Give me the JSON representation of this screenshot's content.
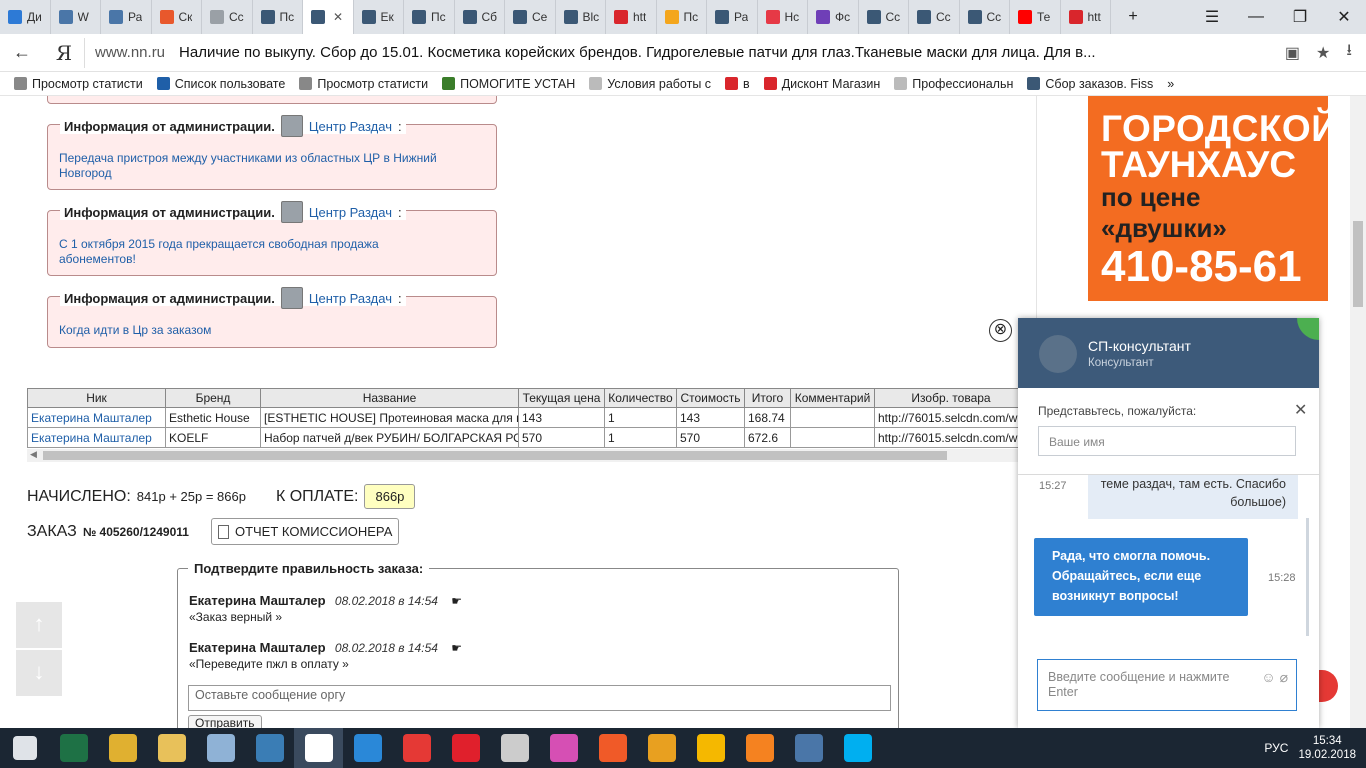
{
  "tabs": [
    {
      "label": "Ди",
      "color": "#2d7ad6"
    },
    {
      "label": "W",
      "color": "#4a76a8"
    },
    {
      "label": "Ра",
      "color": "#4a76a8"
    },
    {
      "label": "Ск",
      "color": "#e8582c"
    },
    {
      "label": "Сс",
      "color": "#9aa0a6"
    },
    {
      "label": "Пс",
      "color": "#3b5875"
    },
    {
      "label": "",
      "color": "#3b5875",
      "active": true
    },
    {
      "label": "Ек",
      "color": "#3b5875"
    },
    {
      "label": "Пс",
      "color": "#3b5875"
    },
    {
      "label": "Сб",
      "color": "#3b5875"
    },
    {
      "label": "Се",
      "color": "#3b5875"
    },
    {
      "label": "Blc",
      "color": "#3b5875"
    },
    {
      "label": "htt",
      "color": "#d9262c"
    },
    {
      "label": "Пс",
      "color": "#f4a61c"
    },
    {
      "label": "Ра",
      "color": "#3b5875"
    },
    {
      "label": "Нс",
      "color": "#e63946"
    },
    {
      "label": "Фс",
      "color": "#6f3fb7"
    },
    {
      "label": "Сс",
      "color": "#3b5875"
    },
    {
      "label": "Сс",
      "color": "#3b5875"
    },
    {
      "label": "Сс",
      "color": "#3b5875"
    },
    {
      "label": "Те",
      "color": "#ff0000"
    },
    {
      "label": "htt",
      "color": "#d9262c"
    }
  ],
  "window": {
    "new_tab": "+",
    "menu": "☰",
    "minimize": "—",
    "maximize": "❐",
    "close": "✕"
  },
  "address": {
    "back": "←",
    "yandex": "Я",
    "domain": "www.nn.ru",
    "title": "Наличие по выкупу. Сбор до 15.01. Косметика корейских брендов. Гидрогелевые патчи для глаз.Тканевые маски для лица. Для в...",
    "download": "⭳",
    "star": "★",
    "lock": "▣"
  },
  "bookmarks": [
    {
      "label": "Просмотр статисти",
      "color": "#888"
    },
    {
      "label": "Список пользовате",
      "color": "#1f5fa8"
    },
    {
      "label": "Просмотр статисти",
      "color": "#888"
    },
    {
      "label": "ПОМОГИТЕ УСТАН",
      "color": "#3a7d2a"
    },
    {
      "label": "Условия работы с",
      "color": "#bbb"
    },
    {
      "label": "в",
      "color": "#d9262c"
    },
    {
      "label": "Дисконт Магазин",
      "color": "#d9262c"
    },
    {
      "label": "Профессиональн",
      "color": "#bbb"
    },
    {
      "label": "Сбор заказов. Fiss",
      "color": "#3b5875"
    }
  ],
  "bookmarks_more": "»",
  "admin": {
    "heading": "Информация от администрации.",
    "who": "Центр Раздач",
    "colon": ":",
    "items": [
      {
        "text": "Передача пристроя между участниками из областных ЦР в Нижний Новгород"
      },
      {
        "text": "С 1 октября 2015 года прекращается свободная продажа абонементов!"
      },
      {
        "text": "Когда идти в Цр за заказом"
      }
    ]
  },
  "close_symbol": "⊗",
  "table": {
    "headers": [
      "Ник",
      "Бренд",
      "Название",
      "Текущая цена",
      "Количество",
      "Стоимость",
      "Итого",
      "Комментарий",
      "Изобр. товара"
    ],
    "rows": [
      [
        "Екатерина Машталер",
        "Esthetic House",
        "[ESTHETIC HOUSE] Протеиновая маска для волос",
        "143",
        "1",
        "143",
        "168.74",
        "",
        "http://76015.selcdn.com/w"
      ],
      [
        "Екатерина Машталер",
        "KOELF",
        "Набор патчей д/век РУБИН/ БОЛГАРСКАЯ РОЗА",
        "570",
        "1",
        "570",
        "672.6",
        "",
        "http://76015.selcdn.com/w"
      ]
    ]
  },
  "summary": {
    "charged_label": "НАЧИСЛЕНО:",
    "charged_value": "841р + 25р = 866р",
    "to_pay_label": "К ОПЛАТЕ:",
    "to_pay_value": "866р",
    "order_label": "ЗАКАЗ",
    "order_number": "№ 405260/1249011",
    "report_button": "ОТЧЕТ КОМИССИОНЕРА"
  },
  "confirm": {
    "legend": "Подтвердите правильность заказа:",
    "messages": [
      {
        "author": "Екатерина Машталер",
        "date": "08.02.2018 в 14:54",
        "text": "«Заказ верный »"
      },
      {
        "author": "Екатерина Машталер",
        "date": "08.02.2018 в 14:54",
        "text": "«Переведите пжл в оплату »"
      }
    ],
    "hand": "☛",
    "placeholder": "Оставьте сообщение оргу",
    "send": "Отправить"
  },
  "scroll_buttons": {
    "up": "↑",
    "down": "↓"
  },
  "ad": {
    "line1": "ГОРОДСКОЙ",
    "line2": "ТАУНХАУС",
    "line3": "по цене «двушки»",
    "phone": "410-85-61",
    "bg_color": "#f36c21"
  },
  "chat": {
    "name": "СП-консультант",
    "role": "Консультант",
    "prompt": "Представьтесь, пожалуйста:",
    "close": "✕",
    "name_placeholder": "Ваше имя",
    "msg1_text": "теме раздач, там есть. Спасибо большое)",
    "msg1_time": "15:27",
    "msg2_text": "Рада, что смогла помочь. Обращайтесь, если еще возникнут вопросы!",
    "msg2_time": "15:28",
    "input_placeholder": "Введите сообщение и нажмите Enter",
    "emoji": "☺",
    "clip": "⌀",
    "header_color": "#3d5a7a",
    "bubble_color": "#2f80d1"
  },
  "taskbar": {
    "apps": [
      {
        "name": "start",
        "color": "#dfe3e8"
      },
      {
        "name": "excel",
        "color": "#1e7145"
      },
      {
        "name": "chrome",
        "color": "#e0b030"
      },
      {
        "name": "explorer",
        "color": "#e8c15a"
      },
      {
        "name": "media",
        "color": "#8fb2d6"
      },
      {
        "name": "game",
        "color": "#3a7db5"
      },
      {
        "name": "yandex",
        "color": "#ffffff",
        "active": true
      },
      {
        "name": "search",
        "color": "#2a88d8"
      },
      {
        "name": "yandex-browser",
        "color": "#e53935"
      },
      {
        "name": "opera",
        "color": "#e0202c"
      },
      {
        "name": "disc",
        "color": "#cccccc"
      },
      {
        "name": "paint",
        "color": "#d64fb4"
      },
      {
        "name": "apps",
        "color": "#f05a28"
      },
      {
        "name": "gg",
        "color": "#e8a020"
      },
      {
        "name": "mail",
        "color": "#f5b800"
      },
      {
        "name": "ok",
        "color": "#f58220"
      },
      {
        "name": "vk",
        "color": "#4a76a8"
      },
      {
        "name": "skype",
        "color": "#00aff0"
      }
    ],
    "language": "РУС",
    "time": "15:34",
    "date": "19.02.2018"
  }
}
